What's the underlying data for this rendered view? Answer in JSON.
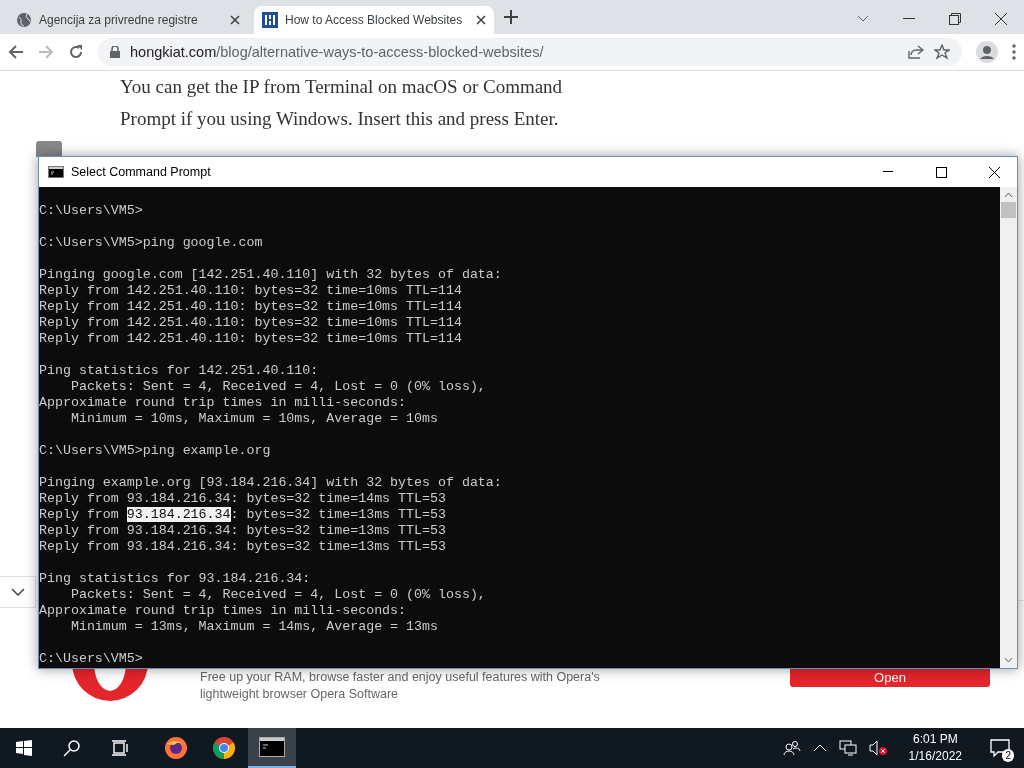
{
  "browser": {
    "tabs": [
      {
        "title": "Agencija za privredne registre",
        "selected": false
      },
      {
        "title": "How to Access Blocked Websites",
        "selected": true
      }
    ],
    "url_host": "hongkiat.com",
    "url_path": "/blog/alternative-ways-to-access-blocked-websites/"
  },
  "article": {
    "paragraph_lines": [
      "You can get the IP from Terminal on macOS or Command",
      "Prompt if you using Windows. Insert this and press Enter."
    ]
  },
  "ad": {
    "text_lines": [
      "Free up your RAM, browse faster and enjoy useful features with Opera's",
      "lightweight browser Opera Software"
    ],
    "button": "Open"
  },
  "console": {
    "title": "Select Command Prompt",
    "blocks": [
      [
        "C:\\Users\\VM5>"
      ],
      [
        "C:\\Users\\VM5>ping google.com"
      ],
      [
        "Pinging google.com [142.251.40.110] with 32 bytes of data:",
        "Reply from 142.251.40.110: bytes=32 time=10ms TTL=114",
        "Reply from 142.251.40.110: bytes=32 time=10ms TTL=114",
        "Reply from 142.251.40.110: bytes=32 time=10ms TTL=114",
        "Reply from 142.251.40.110: bytes=32 time=10ms TTL=114"
      ],
      [
        "Ping statistics for 142.251.40.110:",
        "    Packets: Sent = 4, Received = 4, Lost = 0 (0% loss),",
        "Approximate round trip times in milli-seconds:",
        "    Minimum = 10ms, Maximum = 10ms, Average = 10ms"
      ],
      [
        "C:\\Users\\VM5>ping example.org"
      ],
      [
        "Pinging example.org [93.184.216.34] with 32 bytes of data:",
        "Reply from 93.184.216.34: bytes=32 time=14ms TTL=53",
        {
          "segments": [
            {
              "text": "Reply from ",
              "selected": false
            },
            {
              "text": "93.184.216.34",
              "selected": true
            },
            {
              "text": ": bytes=32 time=13ms TTL=53",
              "selected": false
            }
          ]
        },
        "Reply from 93.184.216.34: bytes=32 time=13ms TTL=53",
        "Reply from 93.184.216.34: bytes=32 time=13ms TTL=53"
      ],
      [
        "Ping statistics for 93.184.216.34:",
        "    Packets: Sent = 4, Received = 4, Lost = 0 (0% loss),",
        "Approximate round trip times in milli-seconds:",
        "    Minimum = 13ms, Maximum = 14ms, Average = 13ms"
      ],
      [
        "C:\\Users\\VM5>"
      ]
    ]
  },
  "taskbar": {
    "apps": [
      {
        "kind": "firefox",
        "selected": false
      },
      {
        "kind": "chrome",
        "selected": false
      },
      {
        "kind": "console",
        "selected": true
      }
    ],
    "time": "6:01 PM",
    "date": "1/16/2022",
    "notification_count": "2"
  }
}
